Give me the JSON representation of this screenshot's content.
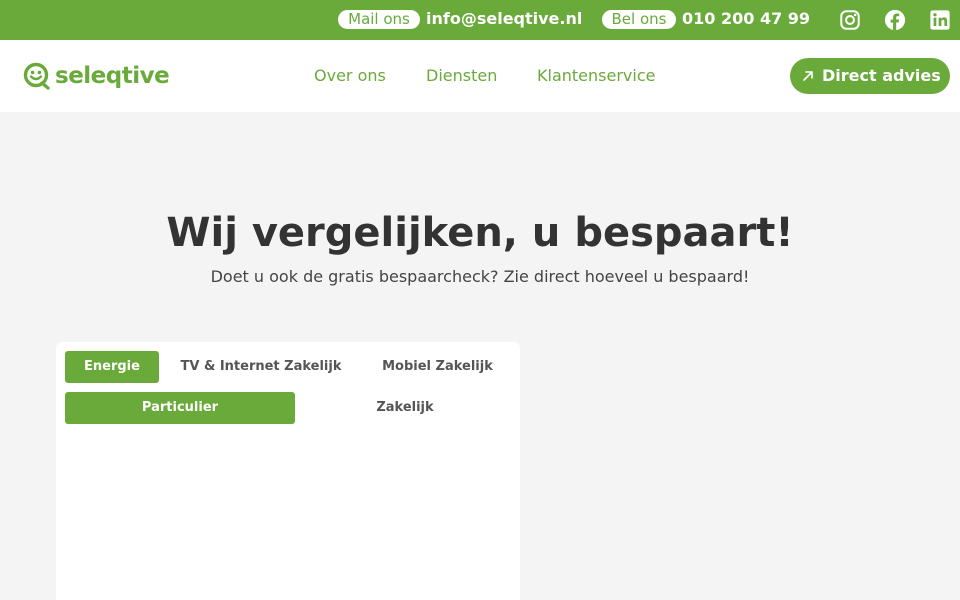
{
  "topbar": {
    "mail_label": "Mail ons",
    "email": "info@seleqtive.nl",
    "call_label": "Bel ons",
    "phone": "010 200 47 99",
    "social": [
      "instagram-icon",
      "facebook-icon",
      "linkedin-icon"
    ]
  },
  "header": {
    "logo_text": "seleqtive",
    "nav": [
      "Over ons",
      "Diensten",
      "Klantenservice"
    ],
    "cta_label": "Direct advies"
  },
  "hero": {
    "title": "Wij vergelijken, u bespaart!",
    "subtitle": "Doet u ook de gratis bespaarcheck? Zie direct hoeveel u bespaard!"
  },
  "card": {
    "tabs": [
      "Energie",
      "TV & Internet Zakelijk",
      "Mobiel Zakelijk"
    ],
    "active_tab": "Energie",
    "subtabs": [
      "Particulier",
      "Zakelijk"
    ],
    "active_subtab": "Particulier"
  },
  "colors": {
    "brand": "#6aaa3a",
    "background": "#f4f4f4",
    "text": "#333333"
  }
}
